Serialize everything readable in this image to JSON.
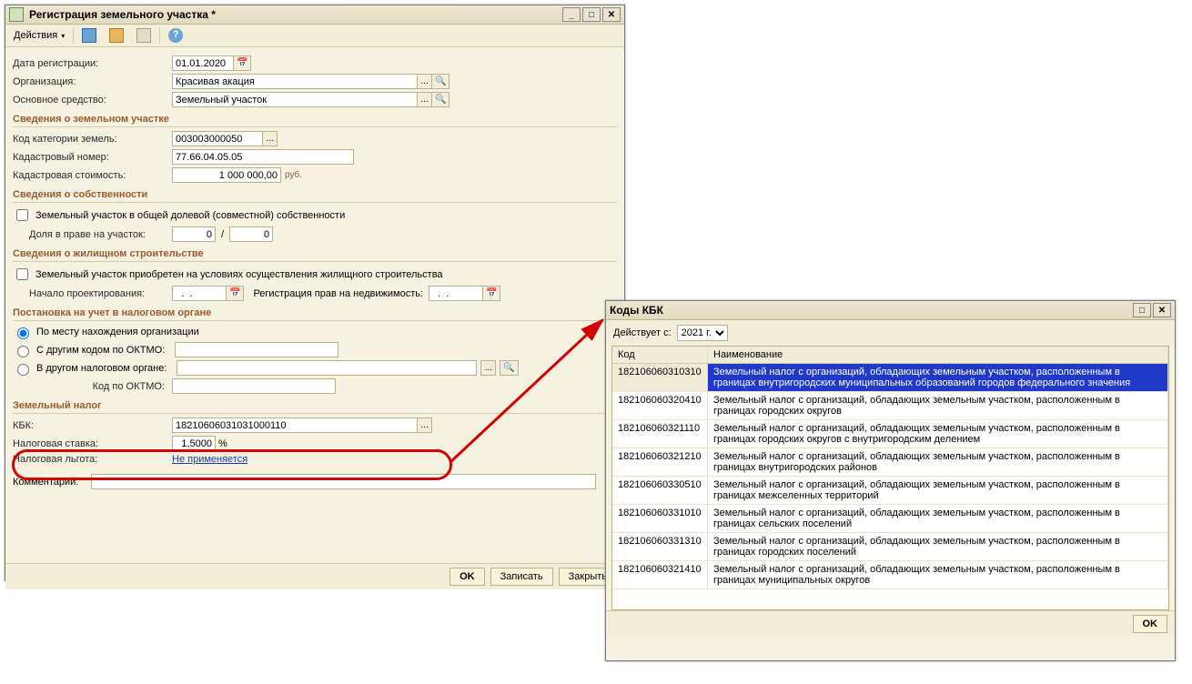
{
  "win1": {
    "title": "Регистрация земельного участка *",
    "toolbar": {
      "actions": "Действия"
    },
    "labels": {
      "date": "Дата регистрации:",
      "org": "Организация:",
      "asset": "Основное средство:",
      "section_land": "Сведения о земельном участке",
      "cat_code": "Код категории земель:",
      "cadastral_no": "Кадастровый номер:",
      "cadastral_val": "Кадастровая стоимость:",
      "currency": "руб.",
      "section_own": "Сведения о собственности",
      "shared": "Земельный участок в общей долевой (совместной) собственности",
      "share": "Доля в праве на участок:",
      "section_housing": "Сведения о жилищном строительстве",
      "housing_cb": "Земельный участок приобретен на условиях осуществления жилищного строительства",
      "design_start": "Начало проектирования:",
      "reg_rights": "Регистрация прав на недвижимость:",
      "section_tax_reg": "Постановка на учет в налоговом органе",
      "radio1": "По месту нахождения организации",
      "radio2": "С другим кодом по ОКТМО:",
      "radio3": "В другом налоговом органе:",
      "oktmo": "Код по ОКТМО:",
      "section_land_tax": "Земельный налог",
      "kbk": "КБК:",
      "rate": "Налоговая ставка:",
      "percent": "%",
      "benefit": "Налоговая льгота:",
      "benefit_value": "Не применяется",
      "comment": "Комментарий:"
    },
    "values": {
      "date": "01.01.2020",
      "org": "Красивая акация",
      "asset": "Земельный участок",
      "cat_code": "003003000050",
      "cadastral_no": "77.66.04.05.05",
      "cadastral_val": "1 000 000,00",
      "share_num": "0",
      "share_den": "0",
      "design_start": "  .  .    ",
      "reg_rights": "  .  .    ",
      "kbk": "18210606031031000110",
      "rate": "1,5000"
    },
    "footer": {
      "ok": "OK",
      "write": "Записать",
      "close": "Закрыть"
    }
  },
  "win2": {
    "title": "Коды КБК",
    "filter_label": "Действует с:",
    "filter_value": "2021 г.",
    "headers": {
      "code": "Код",
      "name": "Наименование"
    },
    "rows": [
      {
        "code": "18210606031​0310",
        "name": "Земельный налог с организаций, обладающих земельным участком, расположенным в границах внутригородских муниципальных образований городов федерального значения",
        "selected": true
      },
      {
        "code": "18210606032​0410",
        "name": "Земельный налог с организаций, обладающих земельным участком, расположенным в границах городских округов"
      },
      {
        "code": "18210606032​1110",
        "name": "Земельный налог с организаций, обладающих земельным участком, расположенным в границах городских округов с внутригородским делением"
      },
      {
        "code": "18210606032​1210",
        "name": "Земельный налог с организаций, обладающих земельным участком, расположенным в границах внутригородских районов"
      },
      {
        "code": "18210606033​0510",
        "name": "Земельный налог с организаций, обладающих земельным участком, расположенным в границах межселенных территорий"
      },
      {
        "code": "18210606033​1010",
        "name": "Земельный налог с организаций, обладающих земельным участком, расположенным в границах сельских поселений"
      },
      {
        "code": "18210606033​1310",
        "name": "Земельный налог с организаций, обладающих земельным участком, расположенным в границах городских поселений"
      },
      {
        "code": "18210606032​1410",
        "name": "Земельный налог с организаций, обладающих земельным участком, расположенным в границах муниципальных округов"
      }
    ],
    "footer": {
      "ok": "OK"
    }
  }
}
